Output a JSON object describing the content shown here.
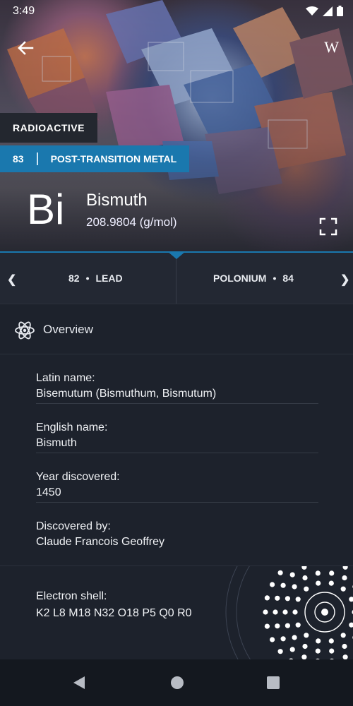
{
  "status_bar": {
    "time": "3:49"
  },
  "header": {
    "wiki_label": "W"
  },
  "element": {
    "badge": "RADIOACTIVE",
    "number": "83",
    "category": "POST-TRANSITION METAL",
    "symbol": "Bi",
    "name": "Bismuth",
    "mass": "208.9804 (g/mol)"
  },
  "neighbors": {
    "prev": {
      "number": "82",
      "name": "LEAD"
    },
    "next": {
      "name": "POLONIUM",
      "number": "84"
    }
  },
  "section": {
    "title": "Overview"
  },
  "details": [
    {
      "label": "Latin name:",
      "value": "Bisemutum (Bismuthum, Bismutum)"
    },
    {
      "label": "English name:",
      "value": "Bismuth"
    },
    {
      "label": "Year discovered:",
      "value": "1450"
    },
    {
      "label": "Discovered by:",
      "value": "Claude Francois Geoffrey"
    }
  ],
  "shell": {
    "label": "Electron shell:",
    "value": "K2 L8 M18 N32 O18 P5 Q0 R0"
  },
  "colors": {
    "accent": "#1a78ae",
    "background": "#1d222c",
    "badge_bg": "#23272f"
  },
  "icons": [
    "back-arrow-icon",
    "wikipedia-icon",
    "fullscreen-icon",
    "atom-icon",
    "chevron-left-icon",
    "chevron-right-icon",
    "nav-back-icon",
    "nav-home-icon",
    "nav-recents-icon"
  ]
}
